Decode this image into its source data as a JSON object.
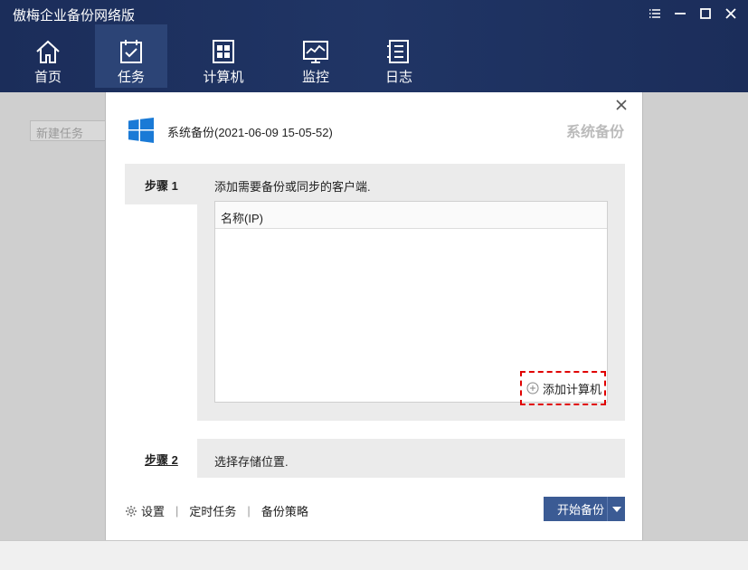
{
  "app": {
    "title": "傲梅企业备份网络版"
  },
  "nav": {
    "items": [
      {
        "label": "首页",
        "icon": "home-icon"
      },
      {
        "label": "任务",
        "icon": "task-icon"
      },
      {
        "label": "计算机",
        "icon": "computer-icon"
      },
      {
        "label": "监控",
        "icon": "monitor-icon"
      },
      {
        "label": "日志",
        "icon": "log-icon"
      }
    ],
    "active": "任务"
  },
  "background": {
    "new_task_placeholder": "新建任务"
  },
  "dialog": {
    "task_name": "系统备份(2021-06-09 15-05-52)",
    "type_label": "系统备份",
    "step1": {
      "label": "步骤 1",
      "description": "添加需要备份或同步的客户端.",
      "table_header": "名称(IP)",
      "add_button": "添加计算机"
    },
    "step2": {
      "label": "步骤 2",
      "description": "选择存储位置."
    },
    "links": {
      "settings": "设置",
      "schedule": "定时任务",
      "strategy": "备份策略"
    },
    "start_button": "开始备份"
  },
  "colors": {
    "header": "#1b2d5a",
    "accent": "#3b5b94",
    "highlight": "#e00000"
  }
}
